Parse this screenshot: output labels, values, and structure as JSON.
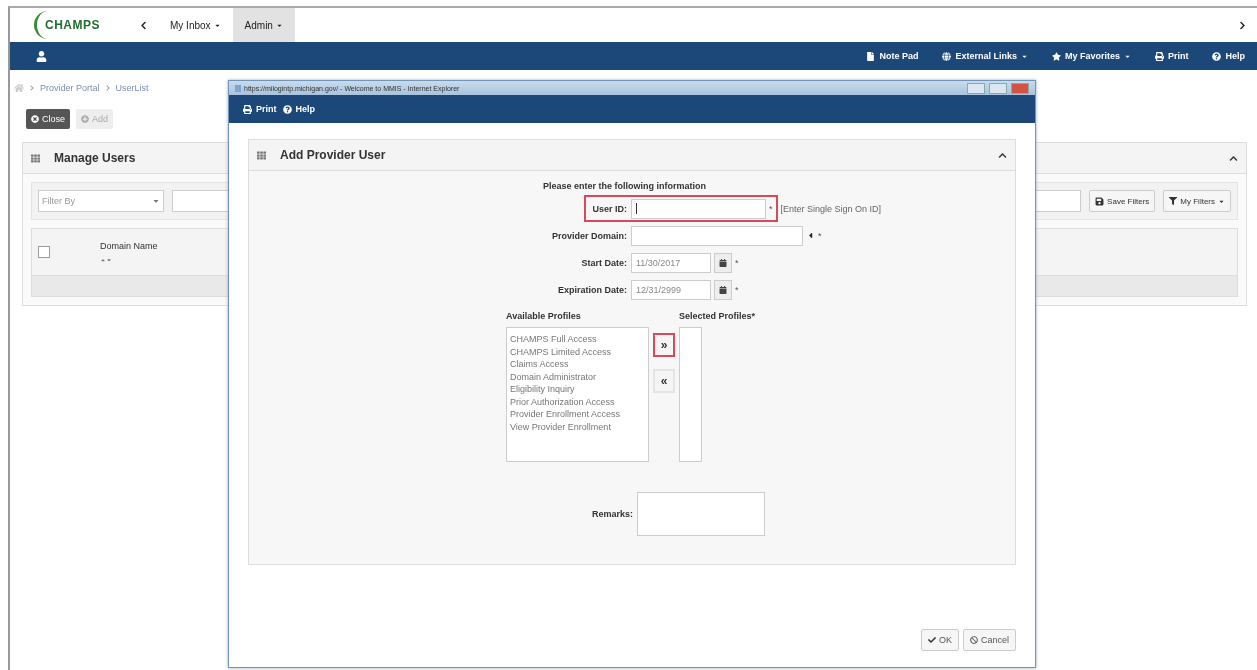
{
  "app": {
    "logo": "CHAMPS",
    "nav": [
      {
        "label": "My Inbox",
        "selected": false
      },
      {
        "label": "Admin",
        "selected": true
      }
    ]
  },
  "toolbar": {
    "links": [
      {
        "label": "Note Pad",
        "dropdown": false
      },
      {
        "label": "External Links",
        "dropdown": true
      },
      {
        "label": "My Favorites",
        "dropdown": true
      },
      {
        "label": "Print",
        "dropdown": false
      },
      {
        "label": "Help",
        "dropdown": false
      }
    ]
  },
  "breadcrumb": [
    "Provider Portal",
    "UserList"
  ],
  "actions": [
    {
      "label": "Close",
      "disabled": false
    },
    {
      "label": "Add",
      "disabled": true
    }
  ],
  "manage_users": {
    "title": "Manage Users",
    "filter": {
      "placeholder": "Filter By"
    },
    "buttons": [
      "Save Filters",
      "My Filters"
    ],
    "columns": [
      "Domain Name"
    ],
    "select_all_checked": false
  },
  "popup": {
    "title": "https://milogintp.michigan.gov/ - Welcome to MMIS - Internet Explorer",
    "toolbar": [
      "Print",
      "Help"
    ],
    "panel_title": "Add Provider User",
    "instruction": "Please enter the following information",
    "fields": [
      {
        "kind": "text",
        "label": "User ID:",
        "marker": "*",
        "hint": "[Enter Single Sign On ID]",
        "highlighted": true
      },
      {
        "kind": "select",
        "label": "Provider Domain:",
        "marker": "*",
        "highlighted": false
      },
      {
        "kind": "date",
        "label": "Start Date:",
        "value": "11/30/2017",
        "marker": "*",
        "highlighted": false
      },
      {
        "kind": "date",
        "label": "Expiration Date:",
        "value": "12/31/2999",
        "marker": "*",
        "highlighted": false
      }
    ],
    "profiles": {
      "available_label": "Available Profiles",
      "selected_label": "Selected Profiles*",
      "available": [
        "CHAMPS Full Access",
        "CHAMPS Limited Access",
        "Claims Access",
        "Domain Administrator",
        "Eligibility Inquiry",
        "Prior Authorization Access",
        "Provider Enrollment Access",
        "View Provider Enrollment"
      ],
      "move_buttons": [
        {
          "label": "»",
          "highlighted": true
        },
        {
          "label": "«",
          "highlighted": false
        }
      ]
    },
    "remarks": {
      "label": "Remarks:"
    },
    "footer_buttons": [
      "OK",
      "Cancel"
    ]
  }
}
